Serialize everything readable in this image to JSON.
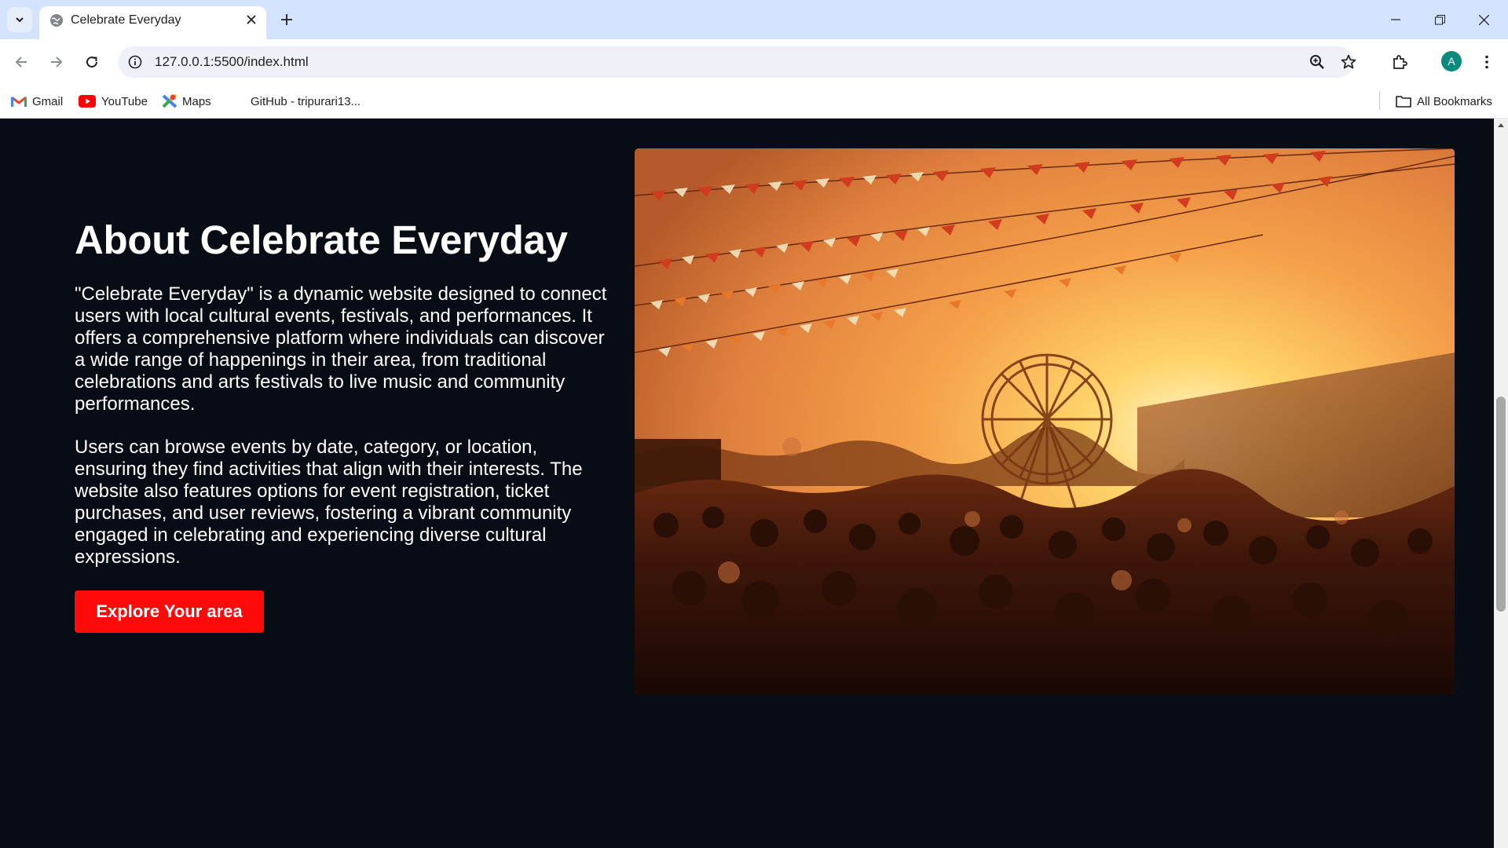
{
  "browser": {
    "tab_title": "Celebrate Everyday",
    "url": "127.0.0.1:5500/index.html",
    "profile_initial": "A",
    "accent_color": "#d3e3fd"
  },
  "bookmarks": {
    "items": [
      {
        "label": "Gmail",
        "icon": "gmail-icon"
      },
      {
        "label": "YouTube",
        "icon": "youtube-icon"
      },
      {
        "label": "Maps",
        "icon": "maps-icon"
      },
      {
        "label": "GitHub - tripurari13...",
        "icon": "github-icon"
      }
    ],
    "all_bookmarks": "All Bookmarks"
  },
  "about": {
    "title": "About Celebrate Everyday",
    "paragraph1": "\"Celebrate Everyday\" is a dynamic website designed to connect users with local cultural events, festivals, and performances. It offers a comprehensive platform where individuals can discover a wide range of happenings in their area, from traditional celebrations and arts festivals to live music and community performances.",
    "paragraph2": "Users can browse events by date, category, or location, ensuring they find activities that align with their interests. The website also features options for event registration, ticket purchases, and user reviews, fostering a vibrant community engaged in celebrating and experiencing diverse cultural expressions.",
    "cta_label": "Explore Your area",
    "cta_color": "#ff0a0a",
    "background_color": "#080c14"
  }
}
